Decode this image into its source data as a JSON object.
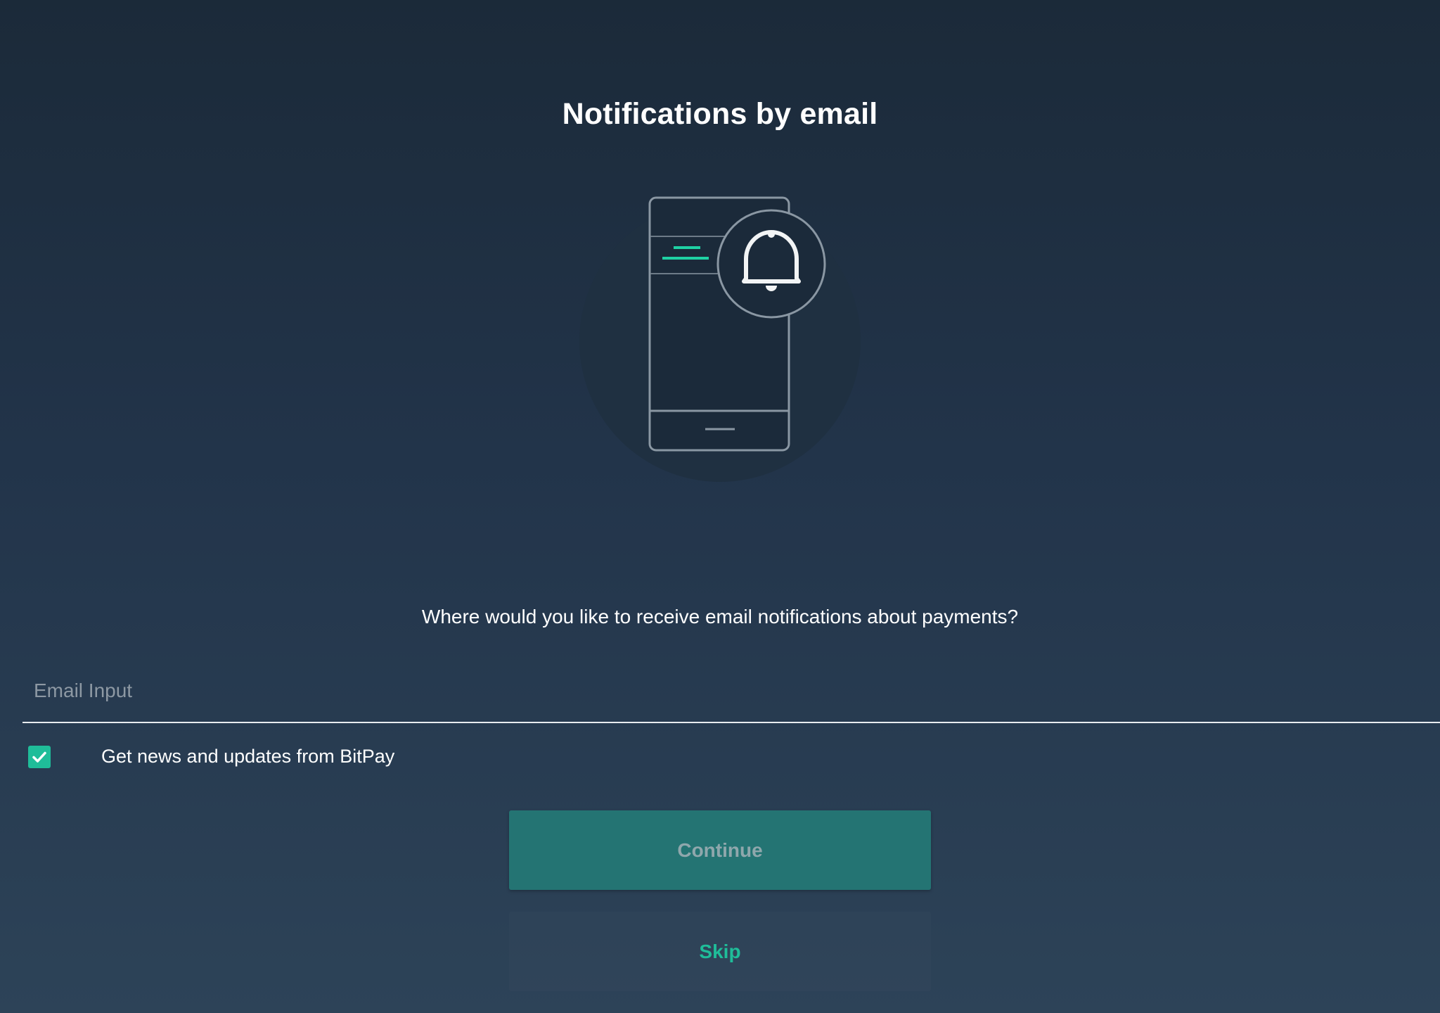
{
  "header": {
    "title": "Notifications by email"
  },
  "illustration": {
    "icon": "phone-notification-bell-icon"
  },
  "form": {
    "question": "Where would you like to receive email notifications about payments?",
    "email_placeholder": "Email Input",
    "email_value": "",
    "newsletter_label": "Get news and updates from BitPay",
    "newsletter_checked": true
  },
  "actions": {
    "continue_label": "Continue",
    "skip_label": "Skip"
  },
  "colors": {
    "accent": "#1fbd99",
    "button_primary": "#247473",
    "background_top": "#1b2a39",
    "background_bottom": "#2d4358"
  }
}
